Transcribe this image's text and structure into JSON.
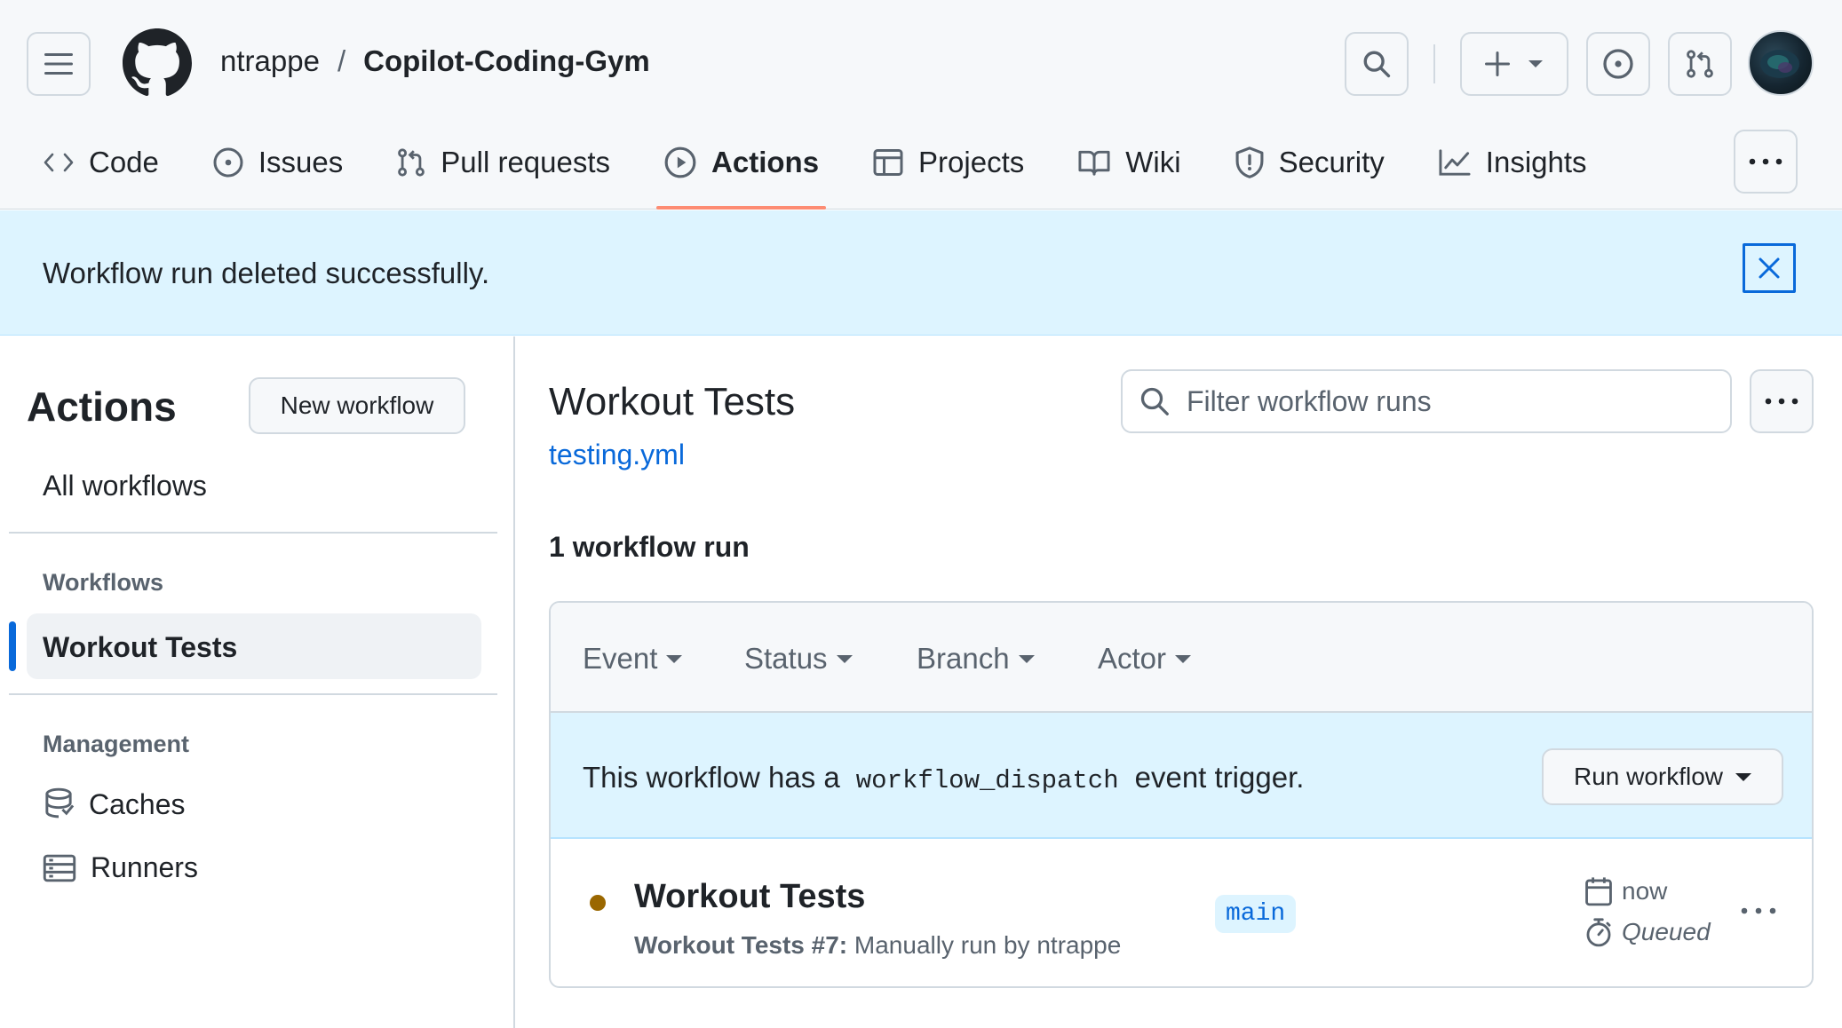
{
  "header": {
    "owner": "ntrappe",
    "separator": "/",
    "repo": "Copilot-Coding-Gym"
  },
  "tabs": [
    {
      "label": "Code",
      "icon": "code-icon"
    },
    {
      "label": "Issues",
      "icon": "issue-opened-icon"
    },
    {
      "label": "Pull requests",
      "icon": "git-pull-request-icon"
    },
    {
      "label": "Actions",
      "icon": "play-icon",
      "selected": true
    },
    {
      "label": "Projects",
      "icon": "table-icon"
    },
    {
      "label": "Wiki",
      "icon": "book-icon"
    },
    {
      "label": "Security",
      "icon": "shield-icon"
    },
    {
      "label": "Insights",
      "icon": "graph-icon"
    }
  ],
  "flash": {
    "message": "Workflow run deleted successfully."
  },
  "sidebar": {
    "title": "Actions",
    "new_workflow_label": "New workflow",
    "all_workflows_label": "All workflows",
    "workflows_heading": "Workflows",
    "workflows": [
      {
        "label": "Workout Tests",
        "selected": true
      }
    ],
    "management_heading": "Management",
    "management_items": [
      {
        "label": "Caches",
        "icon": "database-icon"
      },
      {
        "label": "Runners",
        "icon": "server-icon"
      }
    ]
  },
  "main": {
    "title": "Workout Tests",
    "file_link": "testing.yml",
    "filter_placeholder": "Filter workflow runs",
    "runs_count": "1 workflow run",
    "filters": [
      "Event",
      "Status",
      "Branch",
      "Actor"
    ],
    "dispatch": {
      "text_before": "This workflow has a",
      "code": "workflow_dispatch",
      "text_after": "event trigger.",
      "button_label": "Run workflow"
    },
    "runs": [
      {
        "title": "Workout Tests",
        "subtitle_bold": "Workout Tests #7:",
        "subtitle_rest": "Manually run by ntrappe",
        "branch": "main",
        "time": "now",
        "status": "Queued",
        "status_color": "#9a6700"
      }
    ]
  },
  "colors": {
    "accent": "#0969da",
    "tab_underline": "#fd8c73",
    "flash_bg": "#ddf4ff",
    "queued": "#9a6700"
  }
}
